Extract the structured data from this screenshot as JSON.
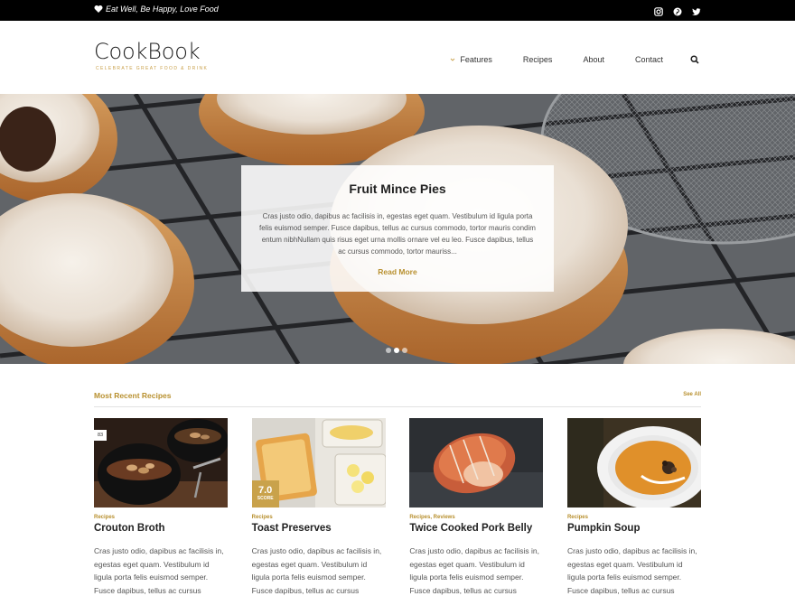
{
  "topbar": {
    "tagline": "Eat Well, Be Happy, Love Food",
    "social": [
      "instagram-icon",
      "pinterest-icon",
      "twitter-icon"
    ]
  },
  "header": {
    "logo_title": "CookBook",
    "logo_subtitle": "CELEBRATE GREAT FOOD & DRINK",
    "nav": [
      "Features",
      "Recipes",
      "About",
      "Contact"
    ]
  },
  "hero": {
    "title": "Fruit Mince Pies",
    "text": "Cras justo odio, dapibus ac facilisis in, egestas eget quam. Vestibulum id ligula porta felis euismod semper. Fusce dapibus, tellus ac cursus commodo, tortor mauris condim entum nibhNullam quis risus eget urna mollis ornare vel eu leo. Fusce dapibus, tellus ac cursus commodo, tortor mauriss...",
    "read_more": "Read More",
    "slides_total": 3,
    "active_slide": 2
  },
  "recent": {
    "title": "Most Recent Recipes",
    "see_all": "See All",
    "cards": [
      {
        "category": "Recipes",
        "title": "Crouton Broth",
        "badge": "83",
        "text": "Cras justo odio, dapibus ac facilisis in, egestas eget quam. Vestibulum id ligula porta felis euismod semper. Fusce dapibus, tellus ac cursus"
      },
      {
        "category": "Recipes",
        "title": "Toast Preserves",
        "score": "7.0",
        "score_label": "SCORE",
        "text": "Cras justo odio, dapibus ac facilisis in, egestas eget quam. Vestibulum id ligula porta felis euismod semper. Fusce dapibus, tellus ac cursus"
      },
      {
        "category": "Recipes, Reviews",
        "title": "Twice Cooked Pork Belly",
        "text": "Cras justo odio, dapibus ac facilisis in, egestas eget quam. Vestibulum id ligula porta felis euismod semper. Fusce dapibus, tellus ac cursus"
      },
      {
        "category": "Recipes",
        "title": "Pumpkin Soup",
        "text": "Cras justo odio, dapibus ac facilisis in, egestas eget quam. Vestibulum id ligula porta felis euismod semper. Fusce dapibus, tellus ac cursus"
      }
    ]
  },
  "colors": {
    "accent": "#b8902f",
    "topbar": "#000000"
  }
}
